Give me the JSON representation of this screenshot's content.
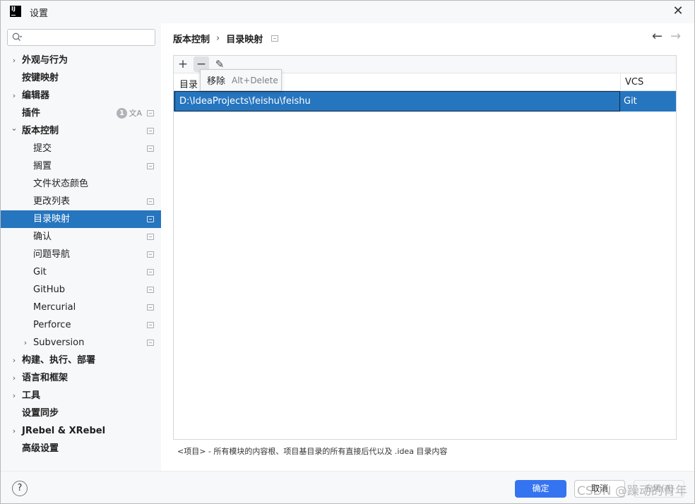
{
  "window": {
    "logo_text": "IJ",
    "title": "设置",
    "close_glyph": "✕"
  },
  "search": {
    "placeholder": ""
  },
  "sidebar": {
    "items": [
      {
        "label": "外观与行为",
        "bold": true,
        "chevron": "›",
        "level": 0
      },
      {
        "label": "按键映射",
        "bold": true,
        "chevron": "",
        "level": 0
      },
      {
        "label": "编辑器",
        "bold": true,
        "chevron": "›",
        "level": 0
      },
      {
        "label": "插件",
        "bold": true,
        "chevron": "",
        "level": 0,
        "badge": "1",
        "translate_icon": "文A",
        "project": true
      },
      {
        "label": "版本控制",
        "bold": true,
        "chevron": "⌄",
        "level": 0,
        "project": true
      },
      {
        "label": "提交",
        "level": 1,
        "project": true
      },
      {
        "label": "搁置",
        "level": 1,
        "project": true
      },
      {
        "label": "文件状态颜色",
        "level": 1
      },
      {
        "label": "更改列表",
        "level": 1,
        "project": true
      },
      {
        "label": "目录映射",
        "level": 1,
        "project": true,
        "selected": true
      },
      {
        "label": "确认",
        "level": 1,
        "project": true
      },
      {
        "label": "问题导航",
        "level": 1,
        "project": true
      },
      {
        "label": "Git",
        "level": 1,
        "project": true
      },
      {
        "label": "GitHub",
        "level": 1,
        "project": true
      },
      {
        "label": "Mercurial",
        "level": 1,
        "project": true
      },
      {
        "label": "Perforce",
        "level": 1,
        "project": true
      },
      {
        "label": "Subversion",
        "level": 1,
        "chevron": "›",
        "project": true
      },
      {
        "label": "构建、执行、部署",
        "bold": true,
        "chevron": "›",
        "level": 0
      },
      {
        "label": "语言和框架",
        "bold": true,
        "chevron": "›",
        "level": 0
      },
      {
        "label": "工具",
        "bold": true,
        "chevron": "›",
        "level": 0
      },
      {
        "label": "设置同步",
        "bold": true,
        "chevron": "",
        "level": 0
      },
      {
        "label": "JRebel & XRebel",
        "bold": true,
        "chevron": "›",
        "level": 0
      },
      {
        "label": "高级设置",
        "bold": true,
        "chevron": "",
        "level": 0
      }
    ]
  },
  "breadcrumb": {
    "parent": "版本控制",
    "separator": "›",
    "current": "目录映射",
    "back": "←",
    "forward": "→"
  },
  "toolbar": {
    "add": "+",
    "remove": "−",
    "edit": "✎"
  },
  "table": {
    "headers": {
      "directory": "目录",
      "vcs": "VCS"
    },
    "rows": [
      {
        "directory": "D:\\IdeaProjects\\feishu\\feishu",
        "vcs": "Git"
      }
    ]
  },
  "tooltip": {
    "action": "移除",
    "shortcut": "Alt+Delete"
  },
  "hint": "<项目> - 所有模块的内容根、项目基目录的所有直接后代以及 .idea 目录内容",
  "footer": {
    "help": "?",
    "ok": "确定",
    "cancel": "取消",
    "apply": "应用(A)"
  },
  "watermark": "CSDN @躁动的青年",
  "colors": {
    "selection": "#2675bf",
    "primary_button": "#3574f0"
  }
}
